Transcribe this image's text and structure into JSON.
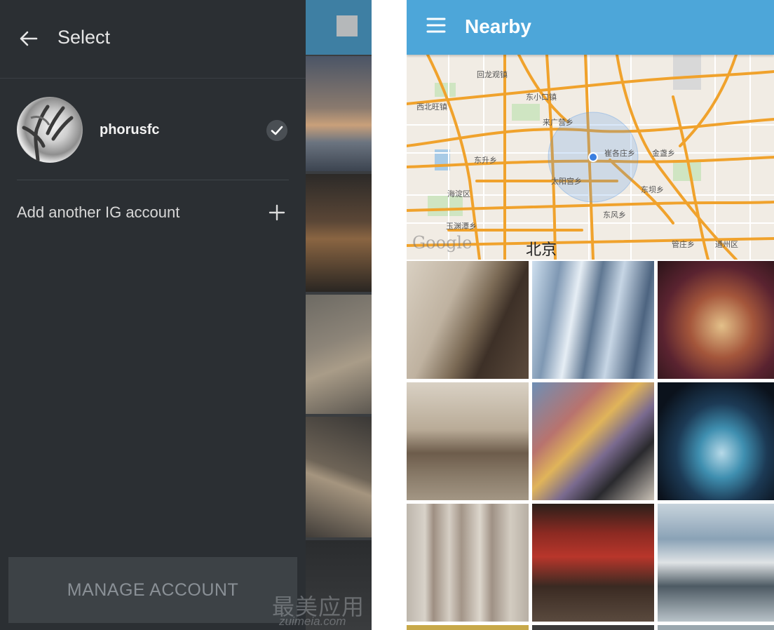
{
  "left_screen": {
    "drawer": {
      "title": "Select",
      "account": {
        "username": "phorusfc",
        "selected": true
      },
      "add_account_label": "Add another IG account",
      "manage_button_label": "MANAGE ACCOUNT"
    },
    "watermark": {
      "cn": "最美应用",
      "en": "zuimeia.com"
    }
  },
  "right_screen": {
    "app_bar": {
      "title": "Nearby"
    },
    "map": {
      "brand": "Google",
      "city_label": "北京",
      "labels": [
        "回龙观镇",
        "东小口镇",
        "西北旺镇",
        "来广营乡",
        "东升乡",
        "崔各庄乡",
        "金盏乡",
        "太阳宫乡",
        "海淀区",
        "东坝乡",
        "玉渊潭乡",
        "东风乡",
        "管庄乡",
        "通州区"
      ]
    },
    "photos": [
      "office-selfie",
      "wangjing-soho-towers",
      "gift-box",
      "street-group",
      "graffiti-wall",
      "night-building",
      "weathered-wall",
      "cafe-menu-board",
      "gallery-paintings"
    ]
  },
  "colors": {
    "drawer_bg": "#2b2f33",
    "app_bar": "#4da6d9",
    "map_road": "#f0a22c",
    "location_dot": "#3b7fe0"
  },
  "icons": [
    "back-arrow-icon",
    "check-icon",
    "plus-icon",
    "hamburger-menu-icon",
    "location-dot-icon"
  ]
}
